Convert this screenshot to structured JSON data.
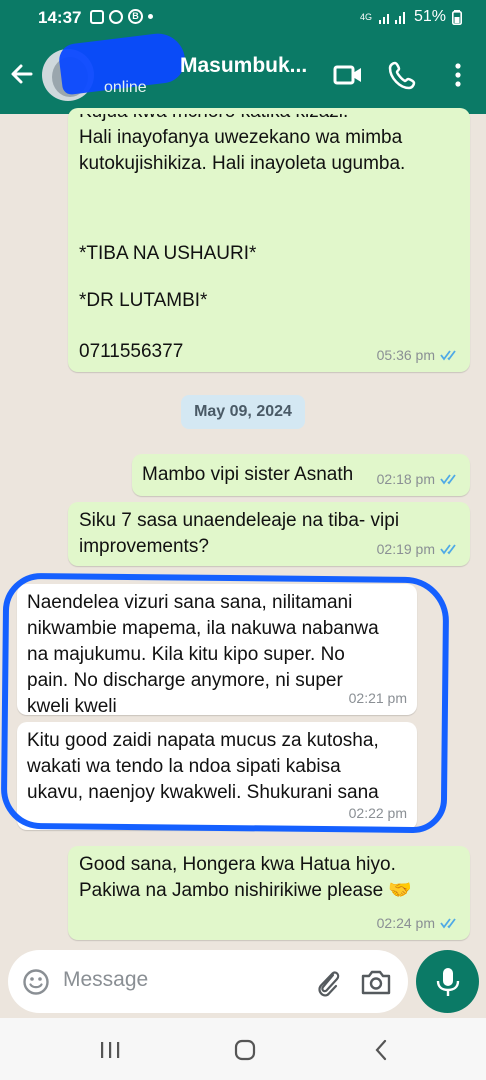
{
  "status_bar": {
    "time": "14:37",
    "network": "4G",
    "battery": "51%",
    "icons": [
      "gallery-icon",
      "chat-bubble-icon",
      "b-icon",
      "dot-icon",
      "signal-icon",
      "battery-icon"
    ]
  },
  "header": {
    "name": "Masumbuk...",
    "status": "online",
    "icons": [
      "back-arrow-icon",
      "video-call-icon",
      "phone-icon",
      "more-vert-icon"
    ]
  },
  "messages": [
    {
      "partial_line": "Kujua kwa mchoro katika kizazi.",
      "lines": [
        "Hali inayofanya uwezekano wa mimba",
        "kutokujishikiza. Hali inayoleta ugumba.",
        "",
        "",
        "*TIBA NA USHAURI*",
        "",
        "*DR LUTAMBI*",
        "",
        "0711556377"
      ],
      "time": "05:36 pm"
    },
    {
      "lines": [
        "Mambo vipi sister Asnath"
      ],
      "time": "02:18 pm"
    },
    {
      "lines": [
        "Siku 7 sasa unaendeleaje na tiba- vipi",
        "improvements?"
      ],
      "time": "02:19 pm"
    },
    {
      "lines": [
        "Naendelea vizuri sana sana, nilitamani",
        "nikwambie mapema, ila nakuwa nabanwa",
        "na majukumu. Kila kitu kipo super. No",
        "pain. No discharge anymore, ni super",
        "kweli kweli"
      ],
      "time": "02:21 pm"
    },
    {
      "lines": [
        "Kitu good zaidi napata mucus za kutosha,",
        "wakati wa tendo la ndoa sipati kabisa",
        "ukavu, naenjoy kwakweli. Shukurani sana"
      ],
      "time": "02:22 pm"
    },
    {
      "lines": [
        "Good sana, Hongera kwa Hatua hiyo.",
        "Pakiwa na Jambo nishirikiwe please 🤝"
      ],
      "time": "02:24 pm"
    }
  ],
  "date_chip": "May 09, 2024",
  "input": {
    "placeholder": "Message"
  },
  "colors": {
    "header": "#0b7a66",
    "outgoing": "#e1f7cb",
    "incoming": "#ffffff",
    "tick": "#4fa9e6",
    "highlight": "#1560ff"
  }
}
